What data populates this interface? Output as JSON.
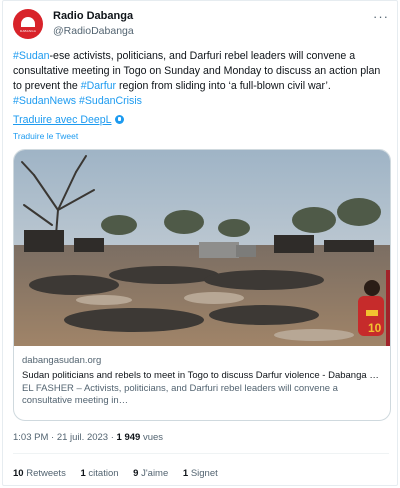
{
  "header": {
    "name": "Radio Dabanga",
    "handle": "@RadioDabanga",
    "avatar_text": "DABANGA",
    "avatar_color": "#d8232a",
    "more_icon": "more-horizontal-icon"
  },
  "tweet": {
    "segments": [
      {
        "text": "#Sudan",
        "tag": true
      },
      {
        "text": "-ese activists, politicians, and Darfuri rebel leaders will convene a consultative meeting in Togo on Sunday and Monday to discuss an action plan to prevent the ",
        "tag": false
      },
      {
        "text": "#Darfur",
        "tag": true
      },
      {
        "text": " region from sliding into ‘a full-blown civil war’. ",
        "tag": false
      },
      {
        "text": "#SudanNews",
        "tag": true
      },
      {
        "text": " ",
        "tag": false
      },
      {
        "text": "#SudanCrisis",
        "tag": true
      }
    ],
    "deepl_label": "Traduire avec DeepL",
    "translate_label": "Traduire le Tweet"
  },
  "link_card": {
    "domain": "dabangasudan.org",
    "title": "Sudan politicians and rebels to meet in Togo to discuss Darfur violence - Dabanga Radio TV Online",
    "description": "EL FASHER – Activists, politicians, and Darfuri rebel leaders will convene a consultative meeting in…",
    "jersey_number": "10"
  },
  "meta": {
    "time": "1:03 PM",
    "date": "21 juil. 2023",
    "separator": "·",
    "views_count": "1 949",
    "views_label": "vues"
  },
  "stats": {
    "retweets_count": "10",
    "retweets_label": "Retweets",
    "quotes_count": "1",
    "quotes_label": "citation",
    "likes_count": "9",
    "likes_label": "J'aime",
    "bookmarks_count": "1",
    "bookmarks_label": "Signet"
  },
  "colors": {
    "accent": "#1d9bf0",
    "text": "#0f1419",
    "muted": "#536471",
    "border": "#cfd9de"
  }
}
